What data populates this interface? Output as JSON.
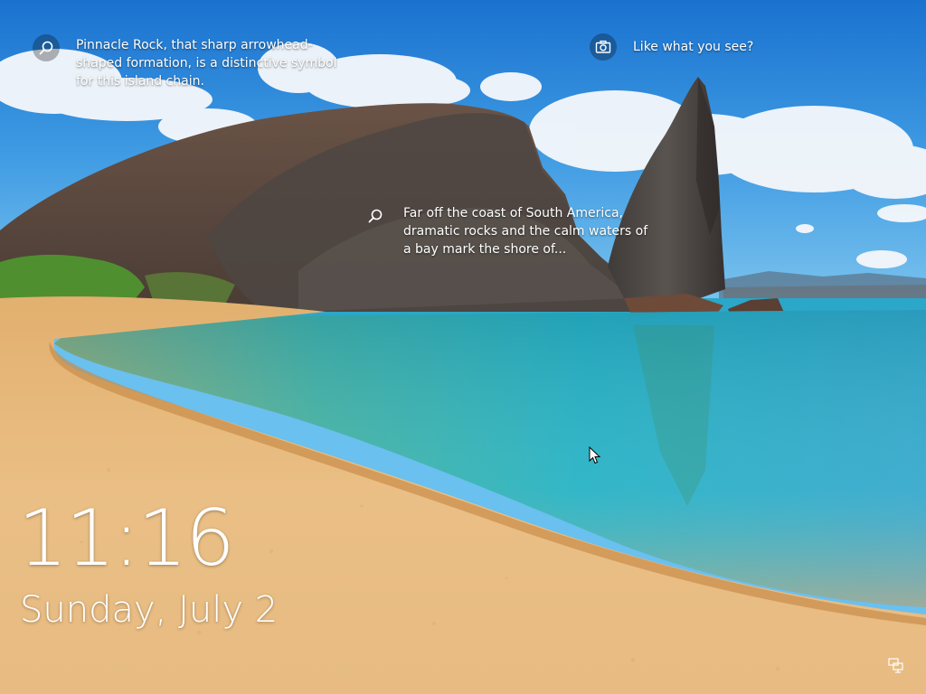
{
  "lockscreen": {
    "time": "11:16",
    "date": "Sunday, July 2"
  },
  "spotlight": {
    "hotspots": [
      {
        "icon": "search-icon",
        "text": "Pinnacle Rock, that sharp arrowhead-shaped formation, is a distinctive symbol for this island chain."
      },
      {
        "icon": "search-icon",
        "text": "Far off the coast of South America, dramatic rocks and the calm waters of a bay mark the shore of..."
      }
    ],
    "like": {
      "icon": "camera-icon",
      "label": "Like what you see?"
    }
  },
  "status": {
    "network_icon": "network-icon"
  },
  "colors": {
    "sky": "#2a88dc",
    "sand": "#e8b877",
    "water": "#2bb7c9",
    "text": "#ffffff"
  }
}
